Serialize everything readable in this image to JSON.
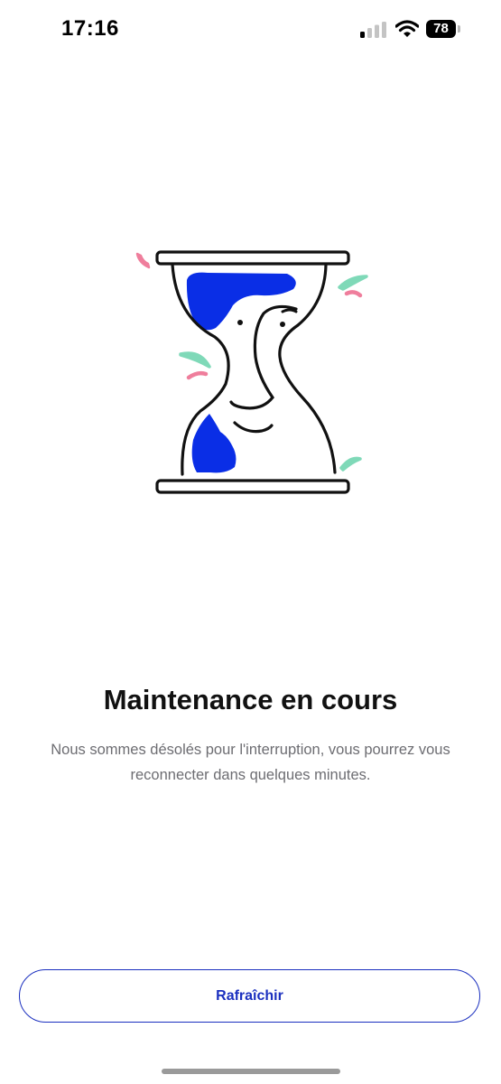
{
  "status_bar": {
    "time": "17:16",
    "battery_level": "78",
    "signal_bars_active": 1,
    "signal_bars_total": 4,
    "icons": [
      "signal-icon",
      "wifi-icon",
      "battery-icon"
    ]
  },
  "illustration": {
    "icon": "hourglass-illustration",
    "colors": {
      "sand": "#0a2ee6",
      "outline": "#111111",
      "accent_mint": "#7fd9b8",
      "accent_pink": "#ef7e9c"
    }
  },
  "content": {
    "title": "Maintenance en cours",
    "message": "Nous sommes désolés pour l'interruption, vous pourrez vous reconnecter dans quelques minutes."
  },
  "actions": {
    "refresh_label": "Rafraîchir"
  },
  "colors": {
    "primary": "#1a2fbf",
    "text": "#111111",
    "muted_text": "#6d6d72",
    "background": "#ffffff"
  }
}
